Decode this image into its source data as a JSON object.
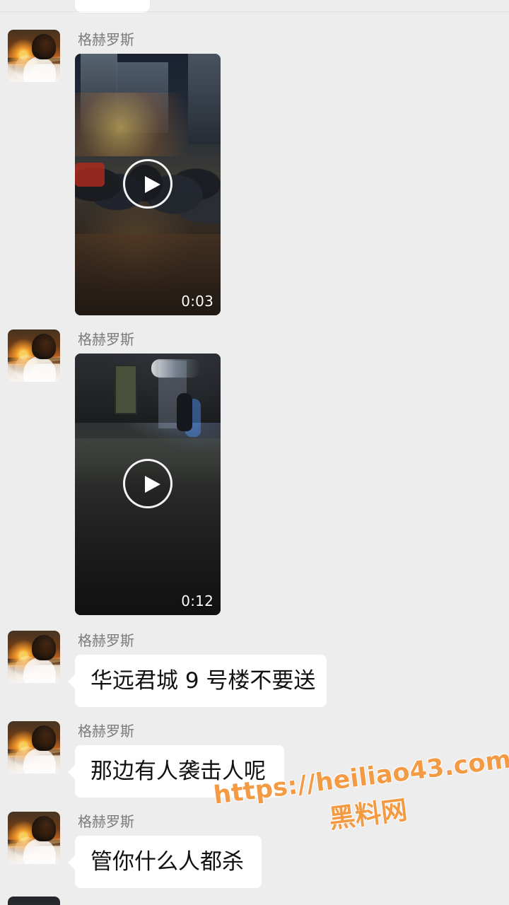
{
  "sender_name": "格赫罗斯",
  "messages": [
    {
      "type": "video",
      "duration": "0:03"
    },
    {
      "type": "video",
      "duration": "0:12"
    },
    {
      "type": "text",
      "text": "华远君城 9 号楼不要送"
    },
    {
      "type": "text",
      "text": "那边有人袭击人呢"
    },
    {
      "type": "text",
      "text": "管你什么人都杀"
    }
  ],
  "watermark": {
    "url": "https://heiliao43.com",
    "label": "黑料网"
  }
}
